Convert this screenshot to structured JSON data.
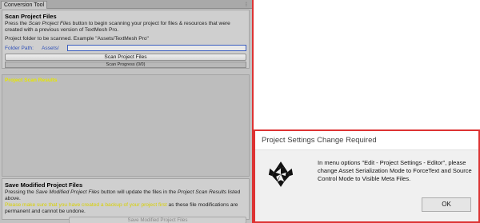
{
  "editor": {
    "tab_title": "Conversion Tool",
    "tab_menu_icon": "menu-dots-icon",
    "scan": {
      "heading": "Scan Project Files",
      "desc_prefix": "Press the ",
      "desc_italic": "Scan Project Files",
      "desc_suffix": " button to begin scanning your project for files & resources that were created with a previous version of TextMesh Pro.",
      "folder_hint": "Project folder to be scanned. Example \"Assets/TextMesh Pro\"",
      "folder_label": "Folder Path:",
      "folder_prefix": "Assets/",
      "folder_value": "",
      "scan_button": "Scan Project Files",
      "progress_text": "Scan Progress (0/0)"
    },
    "results": {
      "title": "Project Scan Results"
    },
    "save": {
      "heading": "Save Modified Project Files",
      "line1_prefix": "Pressing the ",
      "line1_italic": "Save Modified Project Files",
      "line1_mid": " button will update the files in the ",
      "line1_italic2": "Project Scan Results",
      "line1_suffix": " listed above.",
      "line2_highlight": "Please make sure that you have created a backup of your project first",
      "line2_suffix": " as these file modifications are",
      "line3": "permanent and cannot be undone.",
      "save_button": "Save Modified Project Files"
    }
  },
  "dialog": {
    "title": "Project Settings Change Required",
    "icon": "unity-logo-icon",
    "message": "In menu options \"Edit - Project Settings - Editor\", please change Asset Serialization Mode to ForceText and Source Control Mode to Visible Meta Files.",
    "ok_button": "OK"
  },
  "colors": {
    "highlight_border": "#dd3333",
    "label_blue": "#2f50b8",
    "results_title": "#e6e600"
  }
}
